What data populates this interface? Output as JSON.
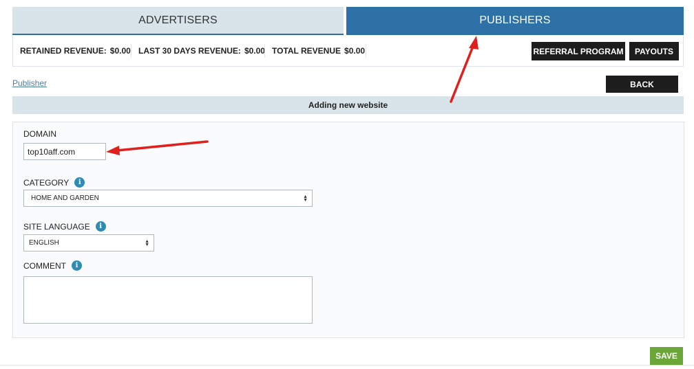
{
  "tabs": {
    "advertisers": "ADVERTISERS",
    "publishers": "PUBLISHERS"
  },
  "stats": {
    "retained_label": "RETAINED REVENUE:",
    "retained_value": "$0.00",
    "last30_label": "LAST 30 DAYS REVENUE:",
    "last30_value": "$0.00",
    "total_label": "TOTAL REVENUE",
    "total_value": "$0.00"
  },
  "actions": {
    "referral": "REFERRAL PROGRAM",
    "payouts": "PAYOUTS",
    "back": "BACK",
    "save": "SAVE"
  },
  "breadcrumb": "Publisher",
  "section_title": "Adding new website",
  "form": {
    "domain_label": "DOMAIN",
    "domain_value": "top10aff.com",
    "category_label": "CATEGORY",
    "category_value": "HOME AND GARDEN",
    "language_label": "SITE LANGUAGE",
    "language_value": "ENGLISH",
    "comment_label": "COMMENT",
    "comment_value": ""
  },
  "icons": {
    "info": "i"
  },
  "colors": {
    "accent": "#2e71a7",
    "tab_inactive": "#d9e4ea",
    "save": "#6aa738",
    "dark_button": "#1d1d1d",
    "annotation_arrow": "#e0201c",
    "info_icon": "#2e8bb4"
  }
}
